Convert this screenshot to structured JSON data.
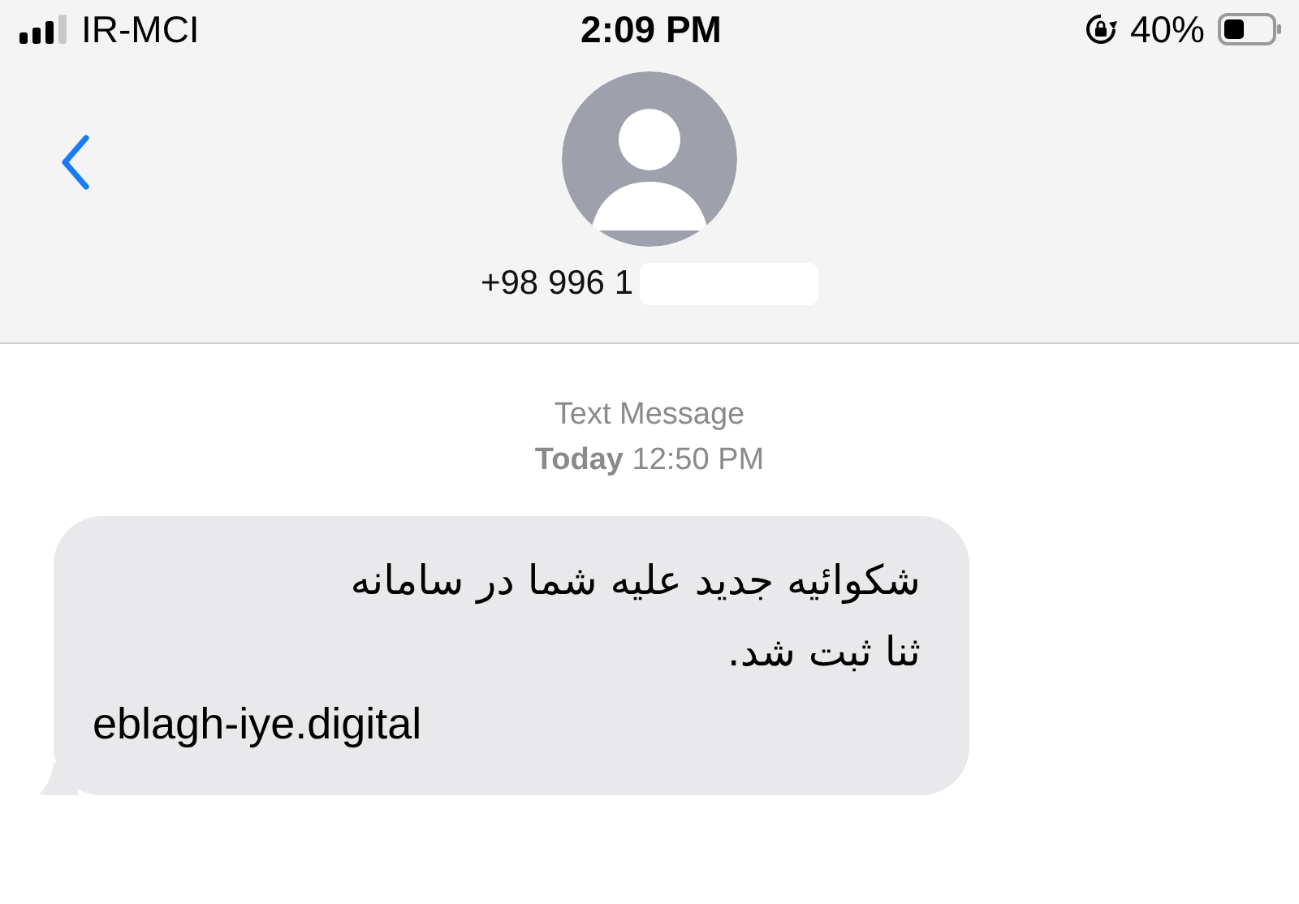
{
  "status_bar": {
    "carrier": "IR-MCI",
    "time": "2:09 PM",
    "battery_percent": "40%"
  },
  "header": {
    "contact": "+98 996 1",
    "number_redacted": true
  },
  "conversation": {
    "service": "Text Message",
    "day": "Today",
    "time": "12:50 PM",
    "messages": [
      {
        "lines": [
          {
            "kind": "persian",
            "text": "شکوائیه جدید علیه شما در سامانه"
          },
          {
            "kind": "persian",
            "text": "ثنا ثبت شد."
          },
          {
            "kind": "link",
            "text": "eblagh-iye.digital"
          }
        ]
      }
    ]
  }
}
